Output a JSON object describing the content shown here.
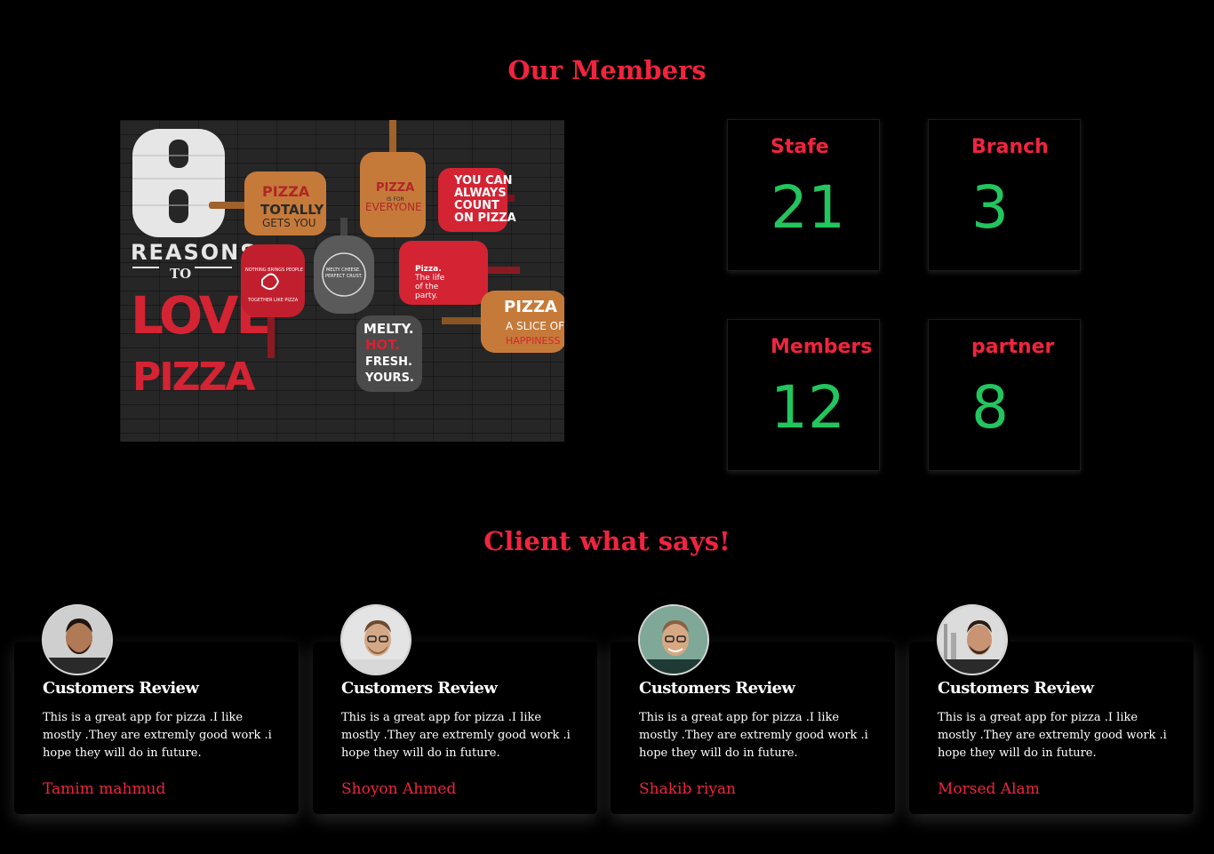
{
  "members_section": {
    "title": "Our Members",
    "poster": {
      "big_number": "8",
      "reasons": "REASONS",
      "to": "TO",
      "love": "LOVE",
      "pizza": "PIZZA",
      "paddles": [
        {
          "line1": "PIZZA",
          "line2": "TOTALLY",
          "line3": "GETS YOU"
        },
        {
          "line1": "PIZZA",
          "line2": "IS FOR",
          "line3": "EVERYONE"
        },
        {
          "line1": "YOU CAN",
          "line2": "ALWAYS",
          "line3": "COUNT",
          "line4": "ON PIZZA"
        },
        {
          "line1": "NOTHING BRINGS PEOPLE",
          "line2": "TOGETHER LIKE PIZZA"
        },
        {
          "line1": "MELTY CHEESE.",
          "line2": "PERFECT CRUST."
        },
        {
          "line1": "Pizza.",
          "line2": "The life",
          "line3": "of the",
          "line4": "party."
        },
        {
          "line1": "MELTY.",
          "line2": "HOT.",
          "line3": "FRESH.",
          "line4": "YOURS."
        },
        {
          "line1": "PIZZA",
          "line2": "A SLICE OF",
          "line3": "HAPPINESS"
        }
      ]
    },
    "stats": [
      {
        "label": "Stafe",
        "value": "21"
      },
      {
        "label": "Branch",
        "value": "3"
      },
      {
        "label": "Members",
        "value": "12"
      },
      {
        "label": "partner",
        "value": "8"
      }
    ]
  },
  "clients_section": {
    "title": "Client what says!",
    "reviews": [
      {
        "title": "Customers Review",
        "text": "This is a great app for pizza .I like mostly .They are extremly good work .i hope they will do in future.",
        "name": "Tamim mahmud"
      },
      {
        "title": "Customers Review",
        "text": "This is a great app for pizza .I like mostly .They are extremly good work .i hope they will do in future.",
        "name": "Shoyon Ahmed"
      },
      {
        "title": "Customers Review",
        "text": "This is a great app for pizza .I like mostly .They are extremly good work .i hope they will do in future.",
        "name": "Shakib riyan"
      },
      {
        "title": "Customers Review",
        "text": "This is a great app for pizza .I like mostly .They are extremly good work .i hope they will do in future.",
        "name": "Morsed Alam"
      }
    ]
  },
  "colors": {
    "accent": "#f0243f",
    "stat_value": "#22c55e",
    "background": "#000000"
  }
}
